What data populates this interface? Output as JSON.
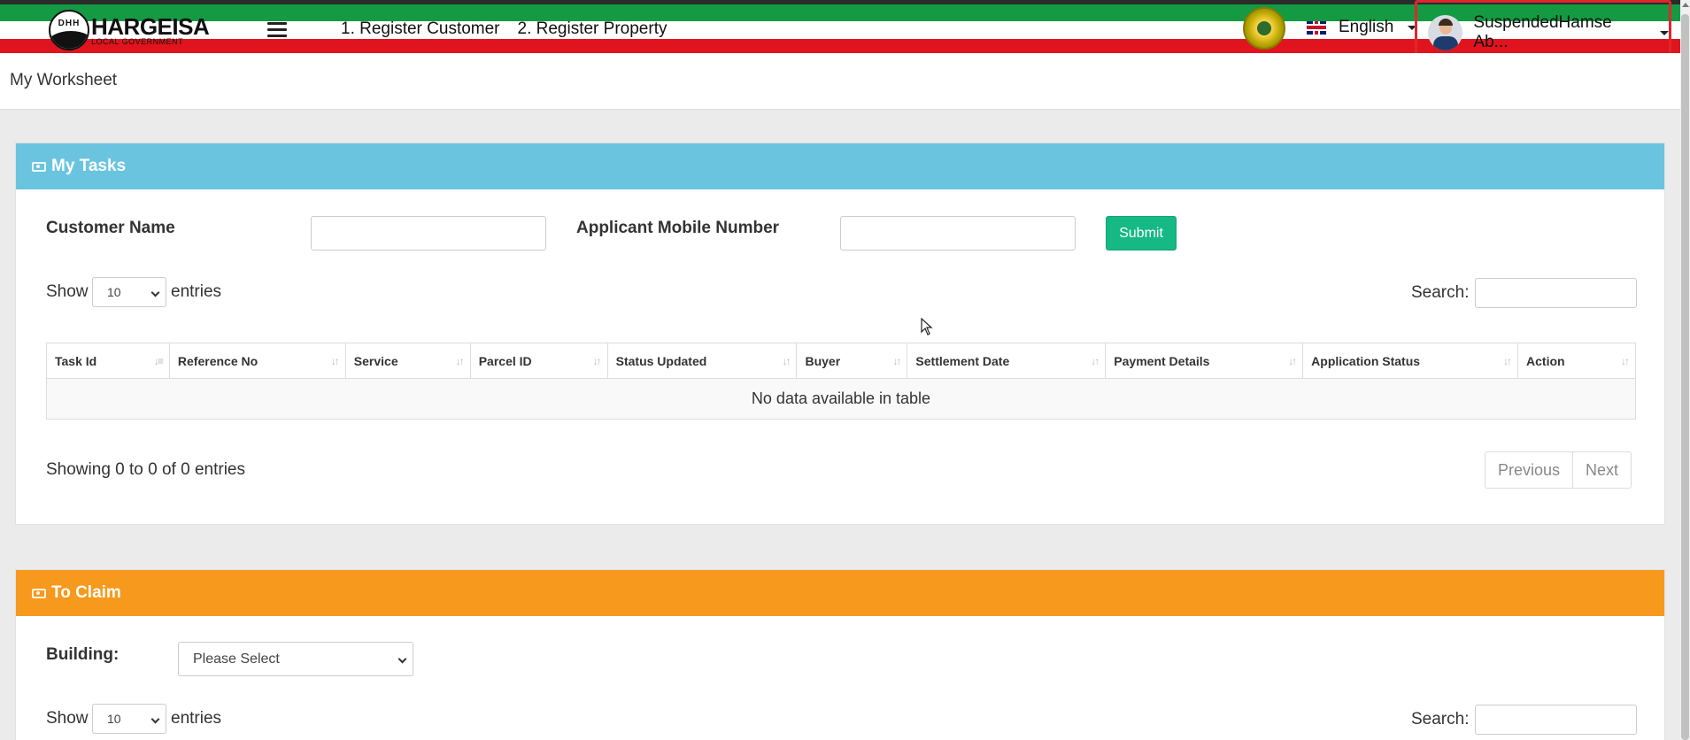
{
  "header": {
    "logo_text": "HARGEISA",
    "logo_subtext": "LOCAL GOVERNMENT",
    "logo_letters": "DHH",
    "nav": [
      {
        "label": "1. Register Customer"
      },
      {
        "label": "2. Register Property"
      }
    ],
    "language": "English",
    "user_name": "SuspendedHamse Ab..."
  },
  "page": {
    "title": "My Worksheet"
  },
  "tasks": {
    "title": "My Tasks",
    "customer_name_label": "Customer Name",
    "customer_name_value": "",
    "mobile_label": "Applicant Mobile Number",
    "mobile_value": "",
    "submit_label": "Submit",
    "show_label": "Show",
    "entries_label": "entries",
    "page_size": "10",
    "search_label": "Search:",
    "columns": [
      "Task Id",
      "Reference No",
      "Service",
      "Parcel ID",
      "Status Updated",
      "Buyer",
      "Settlement Date",
      "Payment Details",
      "Application Status",
      "Action"
    ],
    "empty_message": "No data available in table",
    "info": "Showing 0 to 0 of 0 entries",
    "prev_label": "Previous",
    "next_label": "Next"
  },
  "claim": {
    "title": "To Claim",
    "building_label": "Building:",
    "building_value": "Please Select",
    "show_label": "Show",
    "entries_label": "entries",
    "page_size": "10",
    "search_label": "Search:"
  },
  "colors": {
    "tasks_header": "#6ac4e0",
    "claim_header": "#f7991c",
    "submit": "#16b984",
    "flag_green": "#139a43",
    "flag_red": "#e0141e"
  },
  "icons": [
    "menu-icon",
    "uk-flag-icon",
    "emblem-icon",
    "avatar-icon",
    "camera-icon",
    "sort-icon",
    "chevron-down-icon"
  ]
}
